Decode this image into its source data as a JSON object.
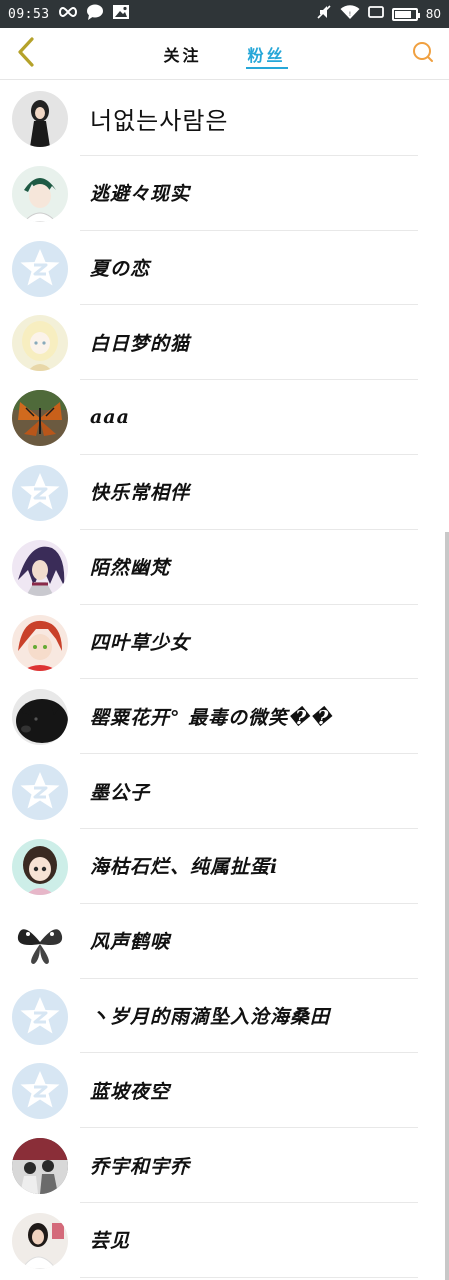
{
  "status_bar": {
    "time": "09:53",
    "battery": "80",
    "battery_level": 0.8,
    "left_icons": [
      "infinity-icon",
      "chat-bubble-icon",
      "image-notification-icon"
    ],
    "right_icons": [
      "mute-icon",
      "wifi-icon",
      "screen-icon",
      "battery-icon"
    ]
  },
  "header": {
    "tabs": [
      {
        "label": "关注",
        "active": false
      },
      {
        "label": "粉丝",
        "active": true
      }
    ],
    "accent_color": "#26a7d8",
    "back_icon_color": "#b5a22a",
    "search_icon_color": "#f0a040"
  },
  "followers": [
    {
      "name": "너없는사람은",
      "avatar": "photo-girl",
      "bg": "#dcdcdc"
    },
    {
      "name": "逃避々现实",
      "avatar": "anime-boy",
      "bg": "#e8f1ec"
    },
    {
      "name": "夏の恋",
      "avatar": "default",
      "bg": "#d7e6f3"
    },
    {
      "name": "白日梦的猫",
      "avatar": "anime-girl",
      "bg": "#f3f0d8"
    },
    {
      "name": "aaa",
      "avatar": "butterfly",
      "bg": "#5a4030"
    },
    {
      "name": "快乐常相伴",
      "avatar": "default",
      "bg": "#d7e6f3"
    },
    {
      "name": "陌然幽梵",
      "avatar": "anime-purple",
      "bg": "#7a5a9a"
    },
    {
      "name": "四叶草少女",
      "avatar": "anime-red",
      "bg": "#e07050"
    },
    {
      "name": "罂粟花开° 最毒の微笑��",
      "avatar": "black-dog",
      "bg": "#1c1c1c"
    },
    {
      "name": "墨公子",
      "avatar": "default",
      "bg": "#d7e6f3"
    },
    {
      "name": "海枯石烂、纯属扯蛋i",
      "avatar": "cartoon-girl",
      "bg": "#cdeee8"
    },
    {
      "name": "风声鹤唳",
      "avatar": "ink-butterfly",
      "bg": "#ffffff"
    },
    {
      "name": "丶岁月的雨滴坠入沧海桑田",
      "avatar": "default",
      "bg": "#d7e6f3"
    },
    {
      "name": "蓝坡夜空",
      "avatar": "default",
      "bg": "#d7e6f3"
    },
    {
      "name": "乔宇和宇乔",
      "avatar": "photo-group",
      "bg": "#6a6a6a"
    },
    {
      "name": "芸见",
      "avatar": "photo-woman",
      "bg": "#eeeeee"
    }
  ]
}
